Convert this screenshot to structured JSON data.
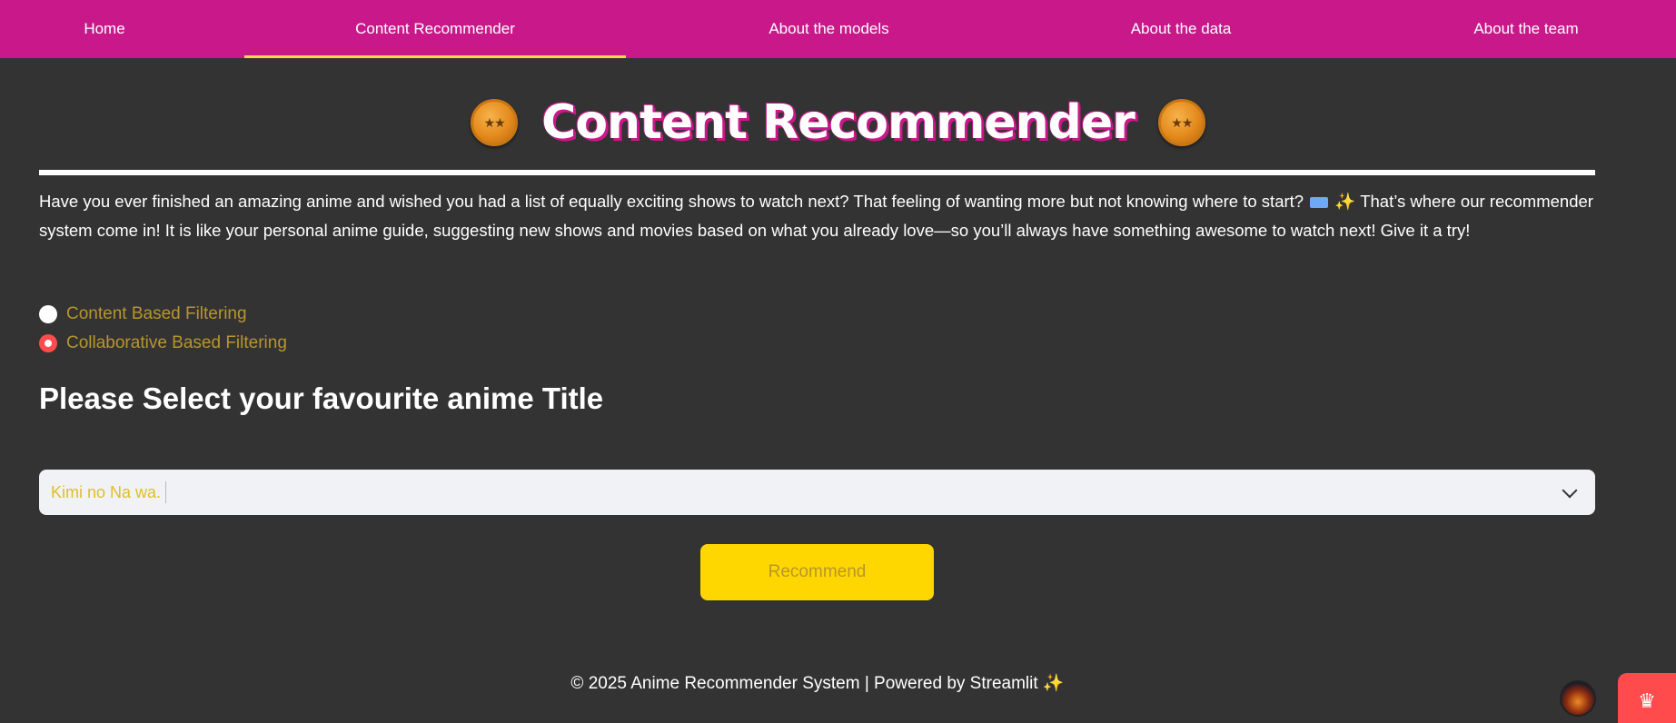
{
  "nav": {
    "items": [
      {
        "label": "Home"
      },
      {
        "label": "Content Recommender"
      },
      {
        "label": "About the models"
      },
      {
        "label": "About the data"
      },
      {
        "label": "About the team"
      }
    ],
    "active_index": 1
  },
  "page": {
    "title": "Content Recommender",
    "title_icon": "star-eyes-emoji-icon",
    "intro_part1": "Have you ever finished an amazing anime and wished you had a list of equally exciting shows to watch next? That feeling of wanting more but not knowing where to start?",
    "intro_part2": "That’s where our recommender system come in! It is like your personal anime guide, suggesting new shows and movies based on what you already love—so you’ll always have something awesome to watch next! Give it a try!"
  },
  "filter": {
    "options": [
      {
        "label": "Content Based Filtering",
        "selected": false
      },
      {
        "label": "Collaborative Based Filtering",
        "selected": true
      }
    ]
  },
  "select": {
    "heading": "Please Select your favourite anime Title",
    "value": "Kimi no Na wa."
  },
  "recommend_button": {
    "label": "Recommend"
  },
  "footer": {
    "text": "© 2025 Anime Recommender System | Powered by Streamlit ✨"
  },
  "colors": {
    "nav_bg": "#C8188A",
    "accent": "#FFD700",
    "bg": "#333333",
    "radio_selected": "#FF4B4B"
  }
}
